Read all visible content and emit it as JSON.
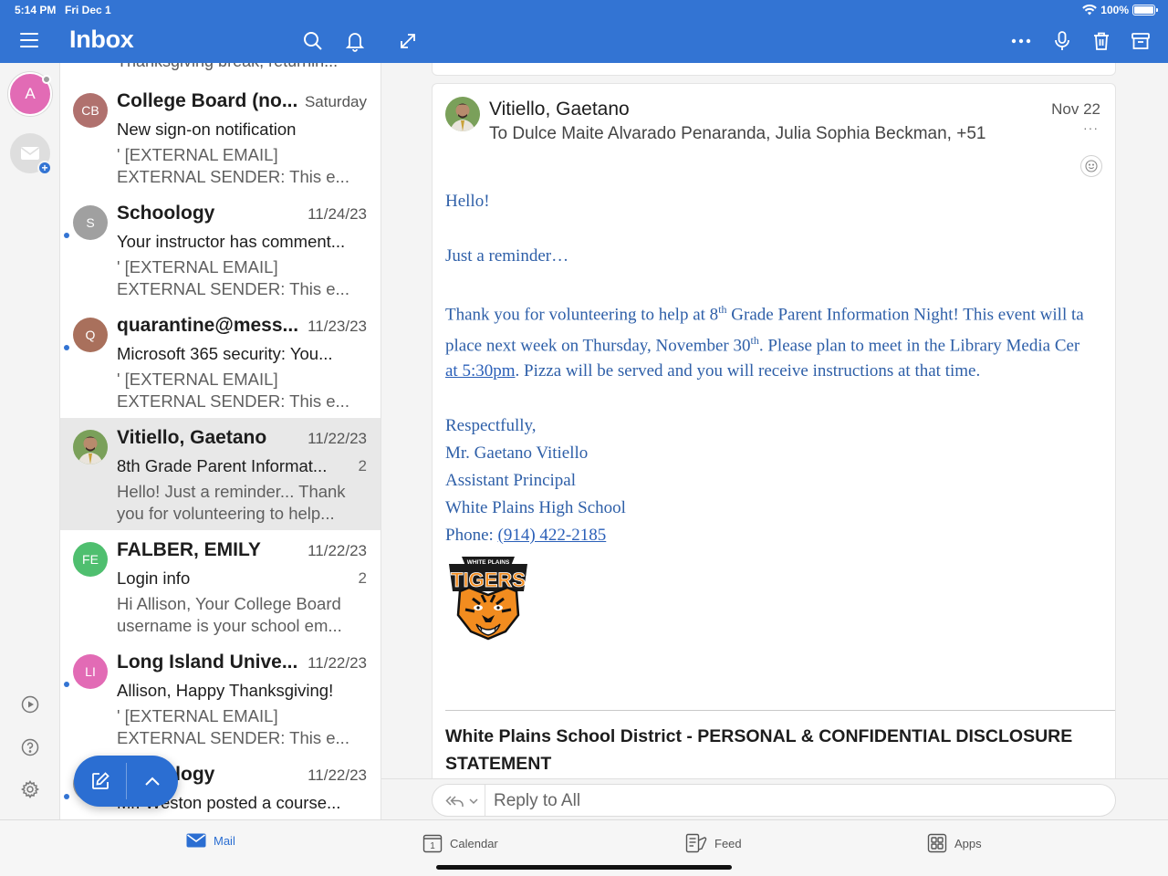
{
  "status_bar": {
    "time": "5:14 PM",
    "date": "Fri Dec 1",
    "battery": "100%"
  },
  "header": {
    "title": "Inbox",
    "icons": [
      "menu-icon",
      "search-icon",
      "bell-icon",
      "expand-icon",
      "more-icon",
      "microphone-icon",
      "trash-icon",
      "archive-icon"
    ]
  },
  "rail": {
    "account_initial": "A",
    "icons": [
      "add-account-icon",
      "play-icon",
      "help-icon",
      "settings-icon"
    ]
  },
  "list": {
    "partial_top": "Thanksgiving break, returnin...",
    "items": [
      {
        "initials": "CB",
        "avatar_color": "#b0716e",
        "sender": "College Board (no...",
        "date": "Saturday",
        "subject": "New sign-on notification",
        "count": "",
        "preview1": "' [EXTERNAL EMAIL]",
        "preview2": "EXTERNAL SENDER: This e...",
        "unread": false
      },
      {
        "initials": "S",
        "avatar_color": "#a0a0a0",
        "sender": "Schoology",
        "date": "11/24/23",
        "subject": "Your instructor has comment...",
        "count": "",
        "preview1": "' [EXTERNAL EMAIL]",
        "preview2": "EXTERNAL SENDER: This e...",
        "unread": true
      },
      {
        "initials": "Q",
        "avatar_color": "#a9705c",
        "sender": "quarantine@mess...",
        "date": "11/23/23",
        "subject": "Microsoft 365 security: You...",
        "count": "",
        "preview1": "' [EXTERNAL EMAIL]",
        "preview2": "EXTERNAL SENDER: This e...",
        "unread": true
      },
      {
        "initials": "",
        "avatar_color": "#6b8f4a",
        "sender": "Vitiello, Gaetano",
        "date": "11/22/23",
        "subject": "8th Grade Parent Informat...",
        "count": "2",
        "preview1": "Hello! Just a reminder... Thank",
        "preview2": "you for volunteering to help...",
        "unread": false,
        "selected": true
      },
      {
        "initials": "FE",
        "avatar_color": "#4fbf6f",
        "sender": "FALBER, EMILY",
        "date": "11/22/23",
        "subject": "Login info",
        "count": "2",
        "preview1": "Hi Allison, Your College Board",
        "preview2": "username is your school em...",
        "unread": false
      },
      {
        "initials": "LI",
        "avatar_color": "#e26bb5",
        "sender": "Long Island Unive...",
        "date": "11/22/23",
        "subject": "Allison, Happy Thanksgiving!",
        "count": "",
        "preview1": "' [EXTERNAL EMAIL]",
        "preview2": "EXTERNAL SENDER: This e...",
        "unread": true
      },
      {
        "initials": "",
        "avatar_color": "#a0a0a0",
        "sender": "Schoology",
        "date": "11/22/23",
        "subject": "Mr. Weston posted a course...",
        "count": "",
        "preview1": "",
        "preview2": "",
        "unread": true
      }
    ]
  },
  "message": {
    "from": "Vitiello, Gaetano",
    "to": "To Dulce Maite Alvarado Penaranda, Julia Sophia Beckman, +51",
    "date": "Nov 22",
    "more": "···",
    "greeting": "Hello!",
    "reminder": "Just a reminder…",
    "p1a": "Thank you for volunteering to help at 8",
    "p1sup": "th",
    "p1b": " Grade Parent Information Night! This event will ta",
    "p2a": "place next week on Thursday, November 30",
    "p2sup": "th",
    "p2b": ".  Please plan to meet in the Library Media Cer",
    "p3link": "at 5:30pm",
    "p3b": ".  Pizza will be served and you will receive instructions at that time.",
    "closing": "Respectfully,",
    "sig_name": "Mr. Gaetano Vitiello",
    "sig_title": "Assistant Principal",
    "sig_school": "White Plains High School",
    "sig_phone_label": "Phone: ",
    "sig_phone": "(914) 422-2185",
    "logo_text_top": "WHITE PLAINS",
    "logo_text_main": "TIGERS",
    "disclaimer": "White Plains School District - PERSONAL & CONFIDENTIAL DISCLOSURE STATEMENT"
  },
  "reply": {
    "label": "Reply to All"
  },
  "tabs": [
    {
      "label": "Mail",
      "icon": "mail-icon",
      "active": true
    },
    {
      "label": "Calendar",
      "icon": "calendar-icon",
      "active": false
    },
    {
      "label": "Feed",
      "icon": "feed-icon",
      "active": false
    },
    {
      "label": "Apps",
      "icon": "apps-icon",
      "active": false
    }
  ],
  "colors": {
    "brand": "#3374d3",
    "link_text": "#2e5fa8",
    "selected_row": "#e8e8e8"
  }
}
